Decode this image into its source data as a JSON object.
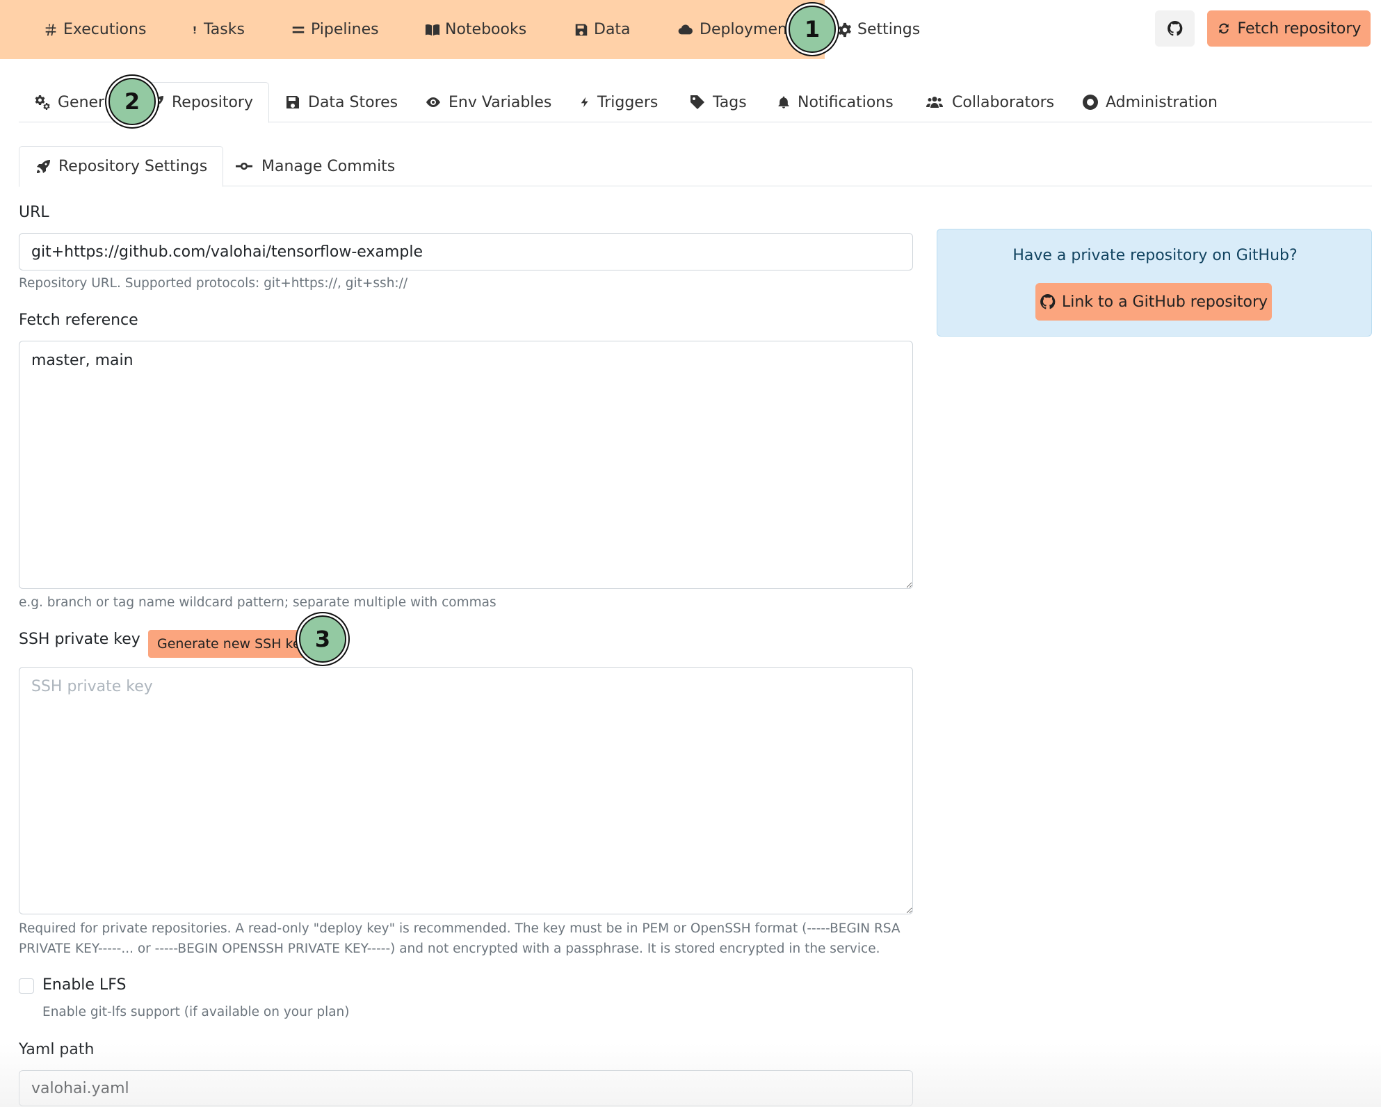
{
  "topnav": {
    "items": [
      {
        "label": "Executions",
        "icon": "hash-icon"
      },
      {
        "label": "Tasks",
        "icon": "exclamation-icon"
      },
      {
        "label": "Pipelines",
        "icon": "equals-icon"
      },
      {
        "label": "Notebooks",
        "icon": "book-icon"
      },
      {
        "label": "Data",
        "icon": "floppy-icon"
      },
      {
        "label": "Deployment",
        "icon": "cloud-icon"
      },
      {
        "label": "Settings",
        "icon": "gear-icon"
      }
    ],
    "github_icon": "github-icon",
    "fetch_label": "Fetch repository",
    "accent_color": "#ffd1a8",
    "button_color": "#fba57e"
  },
  "settings_tabs": [
    {
      "label": "Gener",
      "icon": "gears-icon"
    },
    {
      "label": "Repository",
      "icon": "rocket-icon"
    },
    {
      "label": "Data Stores",
      "icon": "floppy-icon"
    },
    {
      "label": "Env Variables",
      "icon": "eye-icon"
    },
    {
      "label": "Triggers",
      "icon": "bolt-icon"
    },
    {
      "label": "Tags",
      "icon": "tag-icon"
    },
    {
      "label": "Notifications",
      "icon": "bell-icon"
    },
    {
      "label": "Collaborators",
      "icon": "users-icon"
    },
    {
      "label": "Administration",
      "icon": "lifebuoy-icon"
    }
  ],
  "sub_tabs": [
    {
      "label": "Repository Settings",
      "icon": "rocket-icon"
    },
    {
      "label": "Manage Commits",
      "icon": "commit-icon"
    }
  ],
  "form": {
    "url_label": "URL",
    "url_value": "git+https://github.com/valohai/tensorflow-example",
    "url_help": "Repository URL. Supported protocols: git+https://, git+ssh://",
    "fetch_label": "Fetch reference",
    "fetch_value": "master, main",
    "fetch_help": "e.g. branch or tag name wildcard pattern; separate multiple with commas",
    "ssh_label": "SSH private key",
    "ssh_button": "Generate new SSH key",
    "ssh_placeholder": "SSH private key",
    "ssh_help": "Required for private repositories. A read-only \"deploy key\" is recommended. The key must be in PEM or OpenSSH format (-----BEGIN RSA PRIVATE KEY-----... or -----BEGIN OPENSSH PRIVATE KEY-----) and not encrypted with a passphrase. It is stored encrypted in the service.",
    "lfs_label": "Enable LFS",
    "lfs_help": "Enable git-lfs support (if available on your plan)",
    "yaml_label": "Yaml path",
    "yaml_value": "valohai.yaml"
  },
  "side_panel": {
    "title": "Have a private repository on GitHub?",
    "button": "Link to a GitHub repository"
  },
  "markers": [
    "1",
    "2",
    "3"
  ]
}
